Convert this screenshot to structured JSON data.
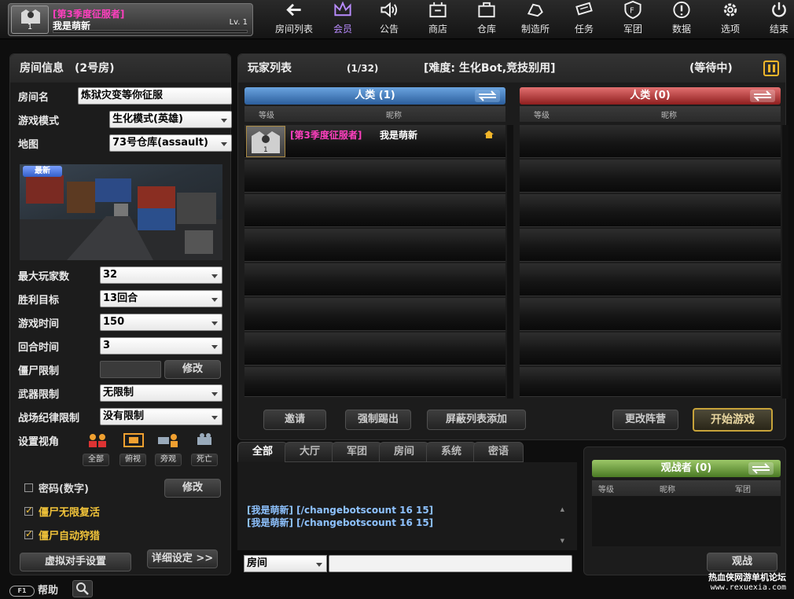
{
  "player": {
    "title": "[第3季度征服者]",
    "name": "我是萌新",
    "level": "Lv. 1",
    "avatar_number": "1"
  },
  "nav": [
    {
      "label": "房间列表",
      "icon": "back-arrow-icon"
    },
    {
      "label": "会员",
      "icon": "crown-icon"
    },
    {
      "label": "公告",
      "icon": "speaker-icon"
    },
    {
      "label": "商店",
      "icon": "shop-icon"
    },
    {
      "label": "仓库",
      "icon": "briefcase-icon"
    },
    {
      "label": "制造所",
      "icon": "hand-icon"
    },
    {
      "label": "任务",
      "icon": "ticket-icon"
    },
    {
      "label": "军团",
      "icon": "shield-icon"
    },
    {
      "label": "数据",
      "icon": "info-icon"
    },
    {
      "label": "选项",
      "icon": "gear-icon"
    },
    {
      "label": "结束",
      "icon": "power-icon"
    }
  ],
  "colors": {
    "accent_purple": "#b98cff",
    "title_pink": "#ff3fbf",
    "gold": "#f2c43a",
    "human_blue": "#2c5e9c",
    "zombie_red": "#8e1e1e",
    "spect_green": "#4a7a24"
  },
  "room": {
    "header": "房间信息",
    "room_no": "(2号房)",
    "name_label": "房间名",
    "name_value": "炼狱灾变等你征服",
    "mode_label": "游戏模式",
    "mode_value": "生化模式(英雄)",
    "map_label": "地图",
    "map_value": "73号仓库(assault)",
    "map_badge": "最新",
    "max_players_label": "最大玩家数",
    "max_players_value": "32",
    "win_label": "胜利目标",
    "win_value": "13回合",
    "game_time_label": "游戏时间",
    "game_time_value": "150",
    "round_time_label": "回合时间",
    "round_time_value": "3",
    "zombie_limit_label": "僵尸限制",
    "zombie_limit_button": "修改",
    "weapon_limit_label": "武器限制",
    "weapon_limit_value": "无限制",
    "discipline_label": "战场纪律限制",
    "discipline_value": "没有限制",
    "view_label": "设置视角",
    "views": [
      "全部",
      "俯视",
      "旁观",
      "死亡"
    ],
    "password_label": "密码(数字)",
    "password_button": "修改",
    "revive_label": "僵尸无限复活",
    "auto_hunt_label": "僵尸自动狩猎",
    "virtual_opponent_button": "虚拟对手设置",
    "detail_button": "详细设定 >>"
  },
  "list": {
    "header": "玩家列表",
    "count": "(1/32)",
    "difficulty": "[难度: 生化Bot,竞技别用]",
    "status": "(等待中)",
    "human_team": "人类 (1)",
    "zombie_team": "人类 (0)",
    "col_level": "等级",
    "col_nick": "昵称",
    "players": [
      {
        "title": "[第3季度征服者]",
        "name": "我是萌新",
        "avatar_number": "1"
      }
    ],
    "buttons": {
      "invite": "邀请",
      "kick": "强制踢出",
      "block": "屏蔽列表添加",
      "change_team": "更改阵营",
      "start": "开始游戏"
    }
  },
  "chat": {
    "tabs": [
      "全部",
      "大厅",
      "军团",
      "房间",
      "系统",
      "密语"
    ],
    "lines": [
      "[我是萌新] [/changebotscount 16 15]",
      "[我是萌新] [/changebotscount 16 15]"
    ],
    "scope": "房间"
  },
  "spectators": {
    "header": "观战者 (0)",
    "col_level": "等级",
    "col_nick": "昵称",
    "col_clan": "军团",
    "watch_button": "观战"
  },
  "footer": {
    "help": "帮助",
    "help_key": "F1"
  },
  "watermark": {
    "text": "热血侠网游单机论坛",
    "url": "www.rexuexia.com"
  }
}
